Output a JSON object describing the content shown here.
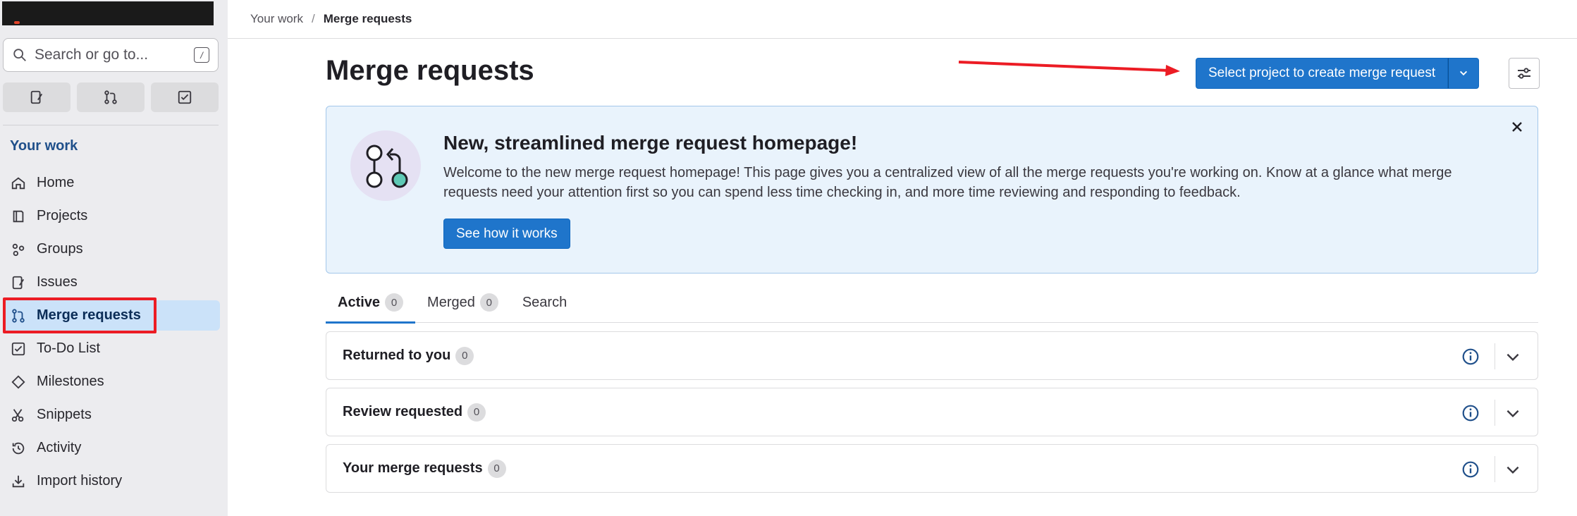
{
  "sidebar": {
    "search_placeholder": "Search or go to...",
    "search_shortcut": "/",
    "quick_actions": [
      "issues-icon",
      "merge-request-icon",
      "todo-icon"
    ],
    "section_title": "Your work",
    "items": [
      {
        "label": "Home",
        "icon": "home-icon"
      },
      {
        "label": "Projects",
        "icon": "project-icon"
      },
      {
        "label": "Groups",
        "icon": "group-icon"
      },
      {
        "label": "Issues",
        "icon": "issues-icon"
      },
      {
        "label": "Merge requests",
        "icon": "merge-request-icon",
        "active": true
      },
      {
        "label": "To-Do List",
        "icon": "todo-icon"
      },
      {
        "label": "Milestones",
        "icon": "milestone-icon"
      },
      {
        "label": "Snippets",
        "icon": "snippet-icon"
      },
      {
        "label": "Activity",
        "icon": "history-icon"
      },
      {
        "label": "Import history",
        "icon": "import-icon"
      }
    ]
  },
  "breadcrumb": {
    "parent": "Your work",
    "separator": "/",
    "current": "Merge requests"
  },
  "page": {
    "title": "Merge requests",
    "primary_button": "Select project to create merge request"
  },
  "banner": {
    "title": "New, streamlined merge request homepage!",
    "text": "Welcome to the new merge request homepage! This page gives you a centralized view of all the merge requests you're working on. Know at a glance what merge requests need your attention first so you can spend less time checking in, and more time reviewing and responding to feedback.",
    "button": "See how it works"
  },
  "tabs": [
    {
      "label": "Active",
      "count": "0",
      "active": true
    },
    {
      "label": "Merged",
      "count": "0"
    },
    {
      "label": "Search"
    }
  ],
  "sections": [
    {
      "title": "Returned to you",
      "count": "0"
    },
    {
      "title": "Review requested",
      "count": "0"
    },
    {
      "title": "Your merge requests",
      "count": "0"
    }
  ],
  "colors": {
    "accent": "#1f75cb",
    "sidebar_bg": "#ececef",
    "annotation": "#ec1c24",
    "banner_bg": "#e9f3fc"
  }
}
